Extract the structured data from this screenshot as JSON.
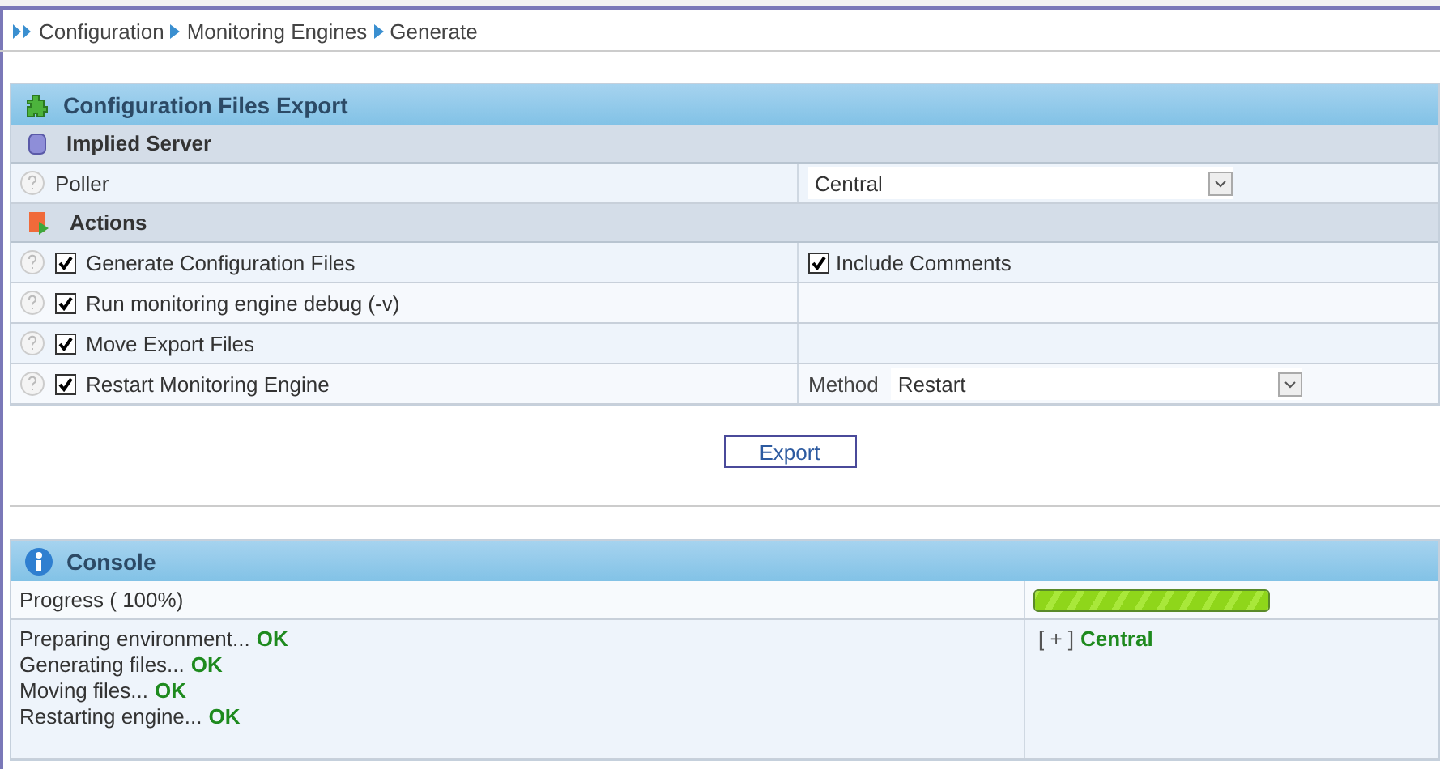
{
  "breadcrumb": [
    "Configuration",
    "Monitoring Engines",
    "Generate"
  ],
  "export_panel": {
    "title": "Configuration Files Export",
    "sections": [
      {
        "title": "Implied Server",
        "kind": "server",
        "rows": [
          {
            "kind": "select",
            "label": "Poller",
            "value": "Central"
          }
        ]
      },
      {
        "title": "Actions",
        "kind": "actions",
        "rows": [
          {
            "kind": "check",
            "label": "Generate Configuration Files",
            "checked": true,
            "extra": {
              "kind": "check",
              "label": "Include Comments",
              "checked": true
            }
          },
          {
            "kind": "check",
            "label": "Run monitoring engine debug (-v)",
            "checked": true
          },
          {
            "kind": "check",
            "label": "Move Export Files",
            "checked": true
          },
          {
            "kind": "check",
            "label": "Restart Monitoring Engine",
            "checked": true,
            "extra": {
              "kind": "select",
              "label": "Method",
              "value": "Restart"
            }
          }
        ]
      }
    ]
  },
  "export_button": "Export",
  "console": {
    "title": "Console",
    "progress_label": "Progress ( 100%)",
    "progress": {
      "level": 1
    },
    "log": [
      {
        "text": "Preparing environment...",
        "status": "OK"
      },
      {
        "text": "Generating files...",
        "status": "OK"
      },
      {
        "text": "Moving files...",
        "status": "OK"
      },
      {
        "text": "Restarting engine...",
        "status": "OK"
      }
    ],
    "toggle": "[ + ]",
    "poller": "Central"
  }
}
